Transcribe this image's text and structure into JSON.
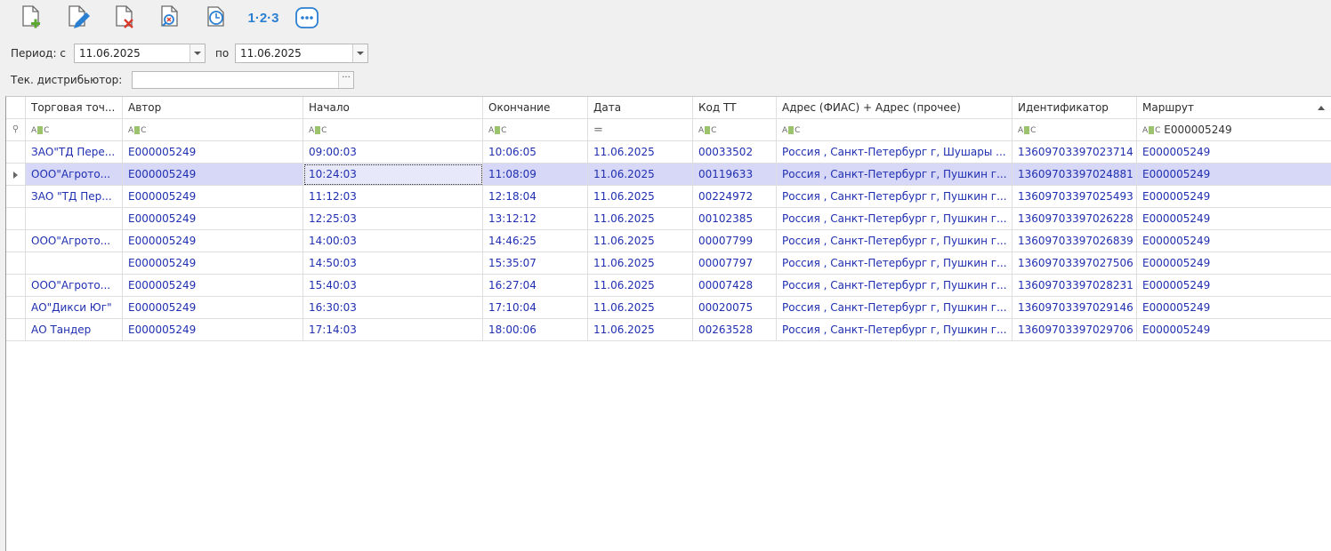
{
  "toolbar": {
    "buttons": [
      {
        "name": "add-document-icon"
      },
      {
        "name": "edit-document-icon"
      },
      {
        "name": "delete-document-icon"
      },
      {
        "name": "view-document-icon"
      },
      {
        "name": "clock-icon"
      },
      {
        "name": "numbering-icon",
        "label": "1·2·3"
      },
      {
        "name": "more-options-icon"
      }
    ]
  },
  "filters": {
    "period_label": "Период: с",
    "date_from": "11.06.2025",
    "to_label": "по",
    "date_to": "11.06.2025",
    "distributor_label": "Тек. дистрибьютор:",
    "distributor_value": ""
  },
  "grid": {
    "columns": [
      "Торговая точ...",
      "Автор",
      "Начало",
      "Окончание",
      "Дата",
      "Код ТТ",
      "Адрес (ФИАС) + Адрес (прочее)",
      "Идентификатор",
      "Маршрут"
    ],
    "filter_row": {
      "route_filter": "E000005249",
      "date_filter": "="
    },
    "rows": [
      [
        "ЗАО\"ТД Пере...",
        "E000005249",
        "09:00:03",
        "10:06:05",
        "11.06.2025",
        "00033502",
        "Россия , Санкт-Петербург г, Шушары ...",
        "13609703397023714",
        "E000005249"
      ],
      [
        "ООО\"Агрото...",
        "E000005249",
        "10:24:03",
        "11:08:09",
        "11.06.2025",
        "00119633",
        "Россия , Санкт-Петербург г, Пушкин г...",
        "13609703397024881",
        "E000005249"
      ],
      [
        "ЗАО \"ТД Пер...",
        "E000005249",
        "11:12:03",
        "12:18:04",
        "11.06.2025",
        "00224972",
        "Россия , Санкт-Петербург г, Пушкин г...",
        "13609703397025493",
        "E000005249"
      ],
      [
        "",
        "E000005249",
        "12:25:03",
        "13:12:12",
        "11.06.2025",
        "00102385",
        "Россия , Санкт-Петербург г, Пушкин г...",
        "13609703397026228",
        "E000005249"
      ],
      [
        "ООО\"Агрото...",
        "E000005249",
        "14:00:03",
        "14:46:25",
        "11.06.2025",
        "00007799",
        "Россия , Санкт-Петербург г, Пушкин г...",
        "13609703397026839",
        "E000005249"
      ],
      [
        "",
        "E000005249",
        "14:50:03",
        "15:35:07",
        "11.06.2025",
        "00007797",
        "Россия , Санкт-Петербург г, Пушкин г...",
        "13609703397027506",
        "E000005249"
      ],
      [
        "ООО\"Агрото...",
        "E000005249",
        "15:40:03",
        "16:27:04",
        "11.06.2025",
        "00007428",
        "Россия , Санкт-Петербург г, Пушкин г...",
        "13609703397028231",
        "E000005249"
      ],
      [
        "АО\"Дикси Юг\"",
        "E000005249",
        "16:30:03",
        "17:10:04",
        "11.06.2025",
        "00020075",
        "Россия , Санкт-Петербург г, Пушкин г...",
        "13609703397029146",
        "E000005249"
      ],
      [
        "АО Тандер",
        "E000005249",
        "17:14:03",
        "18:00:06",
        "11.06.2025",
        "00263528",
        "Россия , Санкт-Петербург г, Пушкин г...",
        "13609703397029706",
        "E000005249"
      ]
    ],
    "selected_row": 1
  },
  "colors": {
    "data_text": "#1f2fb0",
    "selected_row": "#d7d7f7",
    "icon_blue": "#2b7fd1",
    "icon_green": "#5aa832",
    "icon_red": "#d9392b"
  }
}
